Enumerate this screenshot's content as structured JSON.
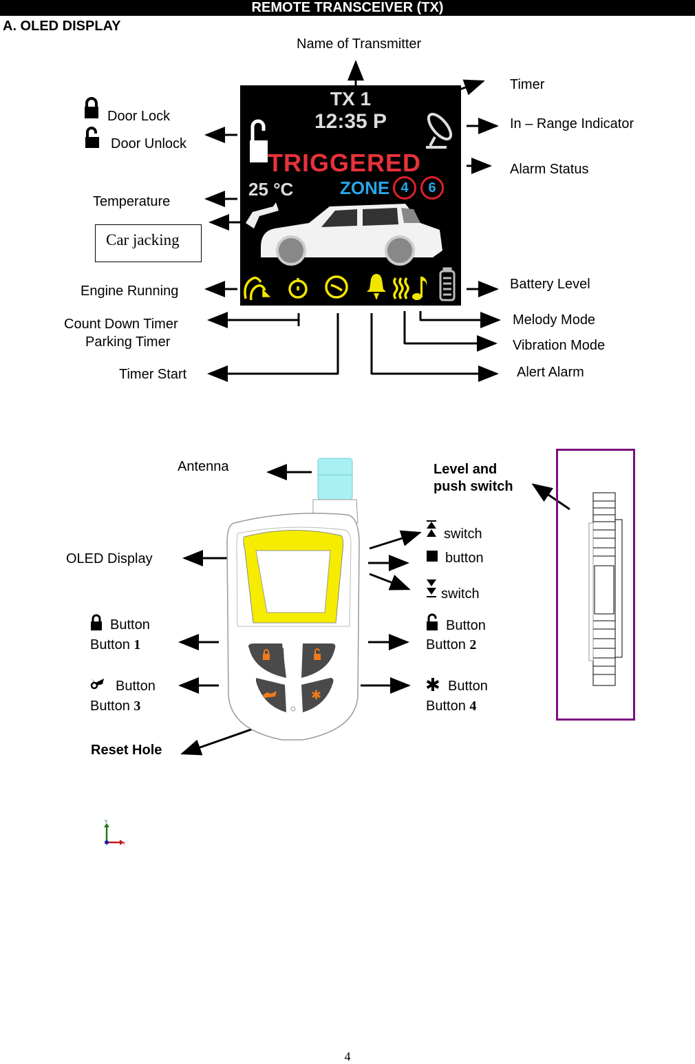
{
  "header": {
    "title": "REMOTE TRANSCEIVER (TX)"
  },
  "section": {
    "title": "A. OLED DISPLAY"
  },
  "oled_screen": {
    "transmitter_name": "TX 1",
    "time": "12:35 P",
    "alarm_status": "TRIGGERED",
    "temperature": "25 °C",
    "zone_label": "ZONE",
    "zones": [
      "4",
      "6"
    ],
    "colors": {
      "alarm": "#e8323a",
      "zone": "#28a6e6",
      "icons": "#f2e600",
      "zone_ring": "#e0202a"
    },
    "icons": [
      "engine-running-icon",
      "stopwatch-icon",
      "clock-icon",
      "bell-icon",
      "vibration-icon",
      "music-note-icon",
      "battery-icon"
    ]
  },
  "display_callouts": {
    "name_of_transmitter": "Name of Transmitter",
    "timer": "Timer",
    "in_range_indicator": "In – Range Indicator",
    "alarm_status": "Alarm Status",
    "battery_level": "Battery Level",
    "door_lock": "Door Lock",
    "door_unlock": "Door Unlock",
    "temperature": "Temperature",
    "car_jacking": "Car jacking",
    "engine_running": "Engine Running",
    "count_down_timer": "Count Down Timer",
    "parking_timer": "Parking Timer",
    "timer_start": "Timer Start",
    "melody_mode": "Melody Mode",
    "vibration_mode": "Vibration Mode",
    "alert_alarm": "Alert Alarm"
  },
  "remote_callouts": {
    "antenna": "Antenna",
    "oled_display": "OLED Display",
    "level_push_switch_line1": "Level and",
    "level_push_switch_line2": "push switch",
    "up_switch": "switch",
    "stop_button": "button",
    "down_switch": "switch",
    "button1_line1": "Button",
    "button1_line2": "Button",
    "button1_num": "1",
    "button2_line1": "Button",
    "button2_line2": "Button",
    "button2_num": "2",
    "button3_line1": "Button",
    "button3_line2": "Button",
    "button3_num": "3",
    "button4_line1": "Button",
    "button4_line2": "Button",
    "button4_num": "4",
    "reset_hole": "Reset Hole",
    "colors": {
      "bezel": "#f5ec00",
      "antenna": "#a8f0f4",
      "keys": "#4a4a4a",
      "key_icons": "#f07a1a",
      "side_box": "#7b0f7e"
    }
  },
  "axis_gizmo": {
    "x_label": "x",
    "y_label": "Y"
  },
  "footer": {
    "page_number": "4"
  }
}
